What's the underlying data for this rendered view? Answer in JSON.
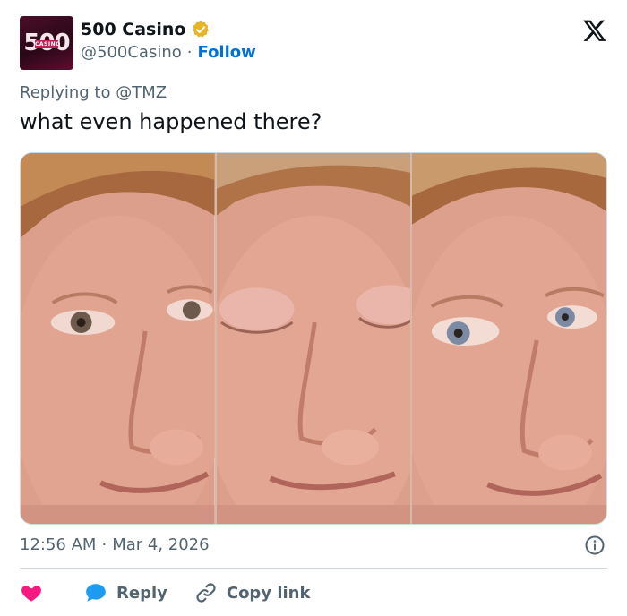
{
  "account": {
    "display_name": "500 Casino",
    "handle": "@500Casino",
    "separator": "·",
    "follow_label": "Follow",
    "avatar_logo_text": "500",
    "avatar_logo_sub": "CASINO",
    "verified_color": "#e8b423"
  },
  "tweet": {
    "replying_to_label": "Replying to",
    "replying_to_handle": "@TMZ",
    "text": "what even happened there?",
    "time": "12:56 AM",
    "date_separator": "·",
    "date": "Mar 4, 2026"
  },
  "media": {
    "description_icons": [
      "face-eyes-open",
      "face-eyes-closed",
      "face-eyes-open-side-glance"
    ]
  },
  "actions": {
    "like_icon": "heart-icon",
    "like_color": "#f91880",
    "reply_label": "Reply",
    "reply_icon": "speech-bubble-icon",
    "reply_icon_color": "#1d9bf0",
    "copy_link_label": "Copy link",
    "copy_link_icon": "link-icon"
  },
  "colors": {
    "text_primary": "#0f1419",
    "text_secondary": "#536471",
    "link": "#006fd6",
    "border": "#cfd9de"
  }
}
